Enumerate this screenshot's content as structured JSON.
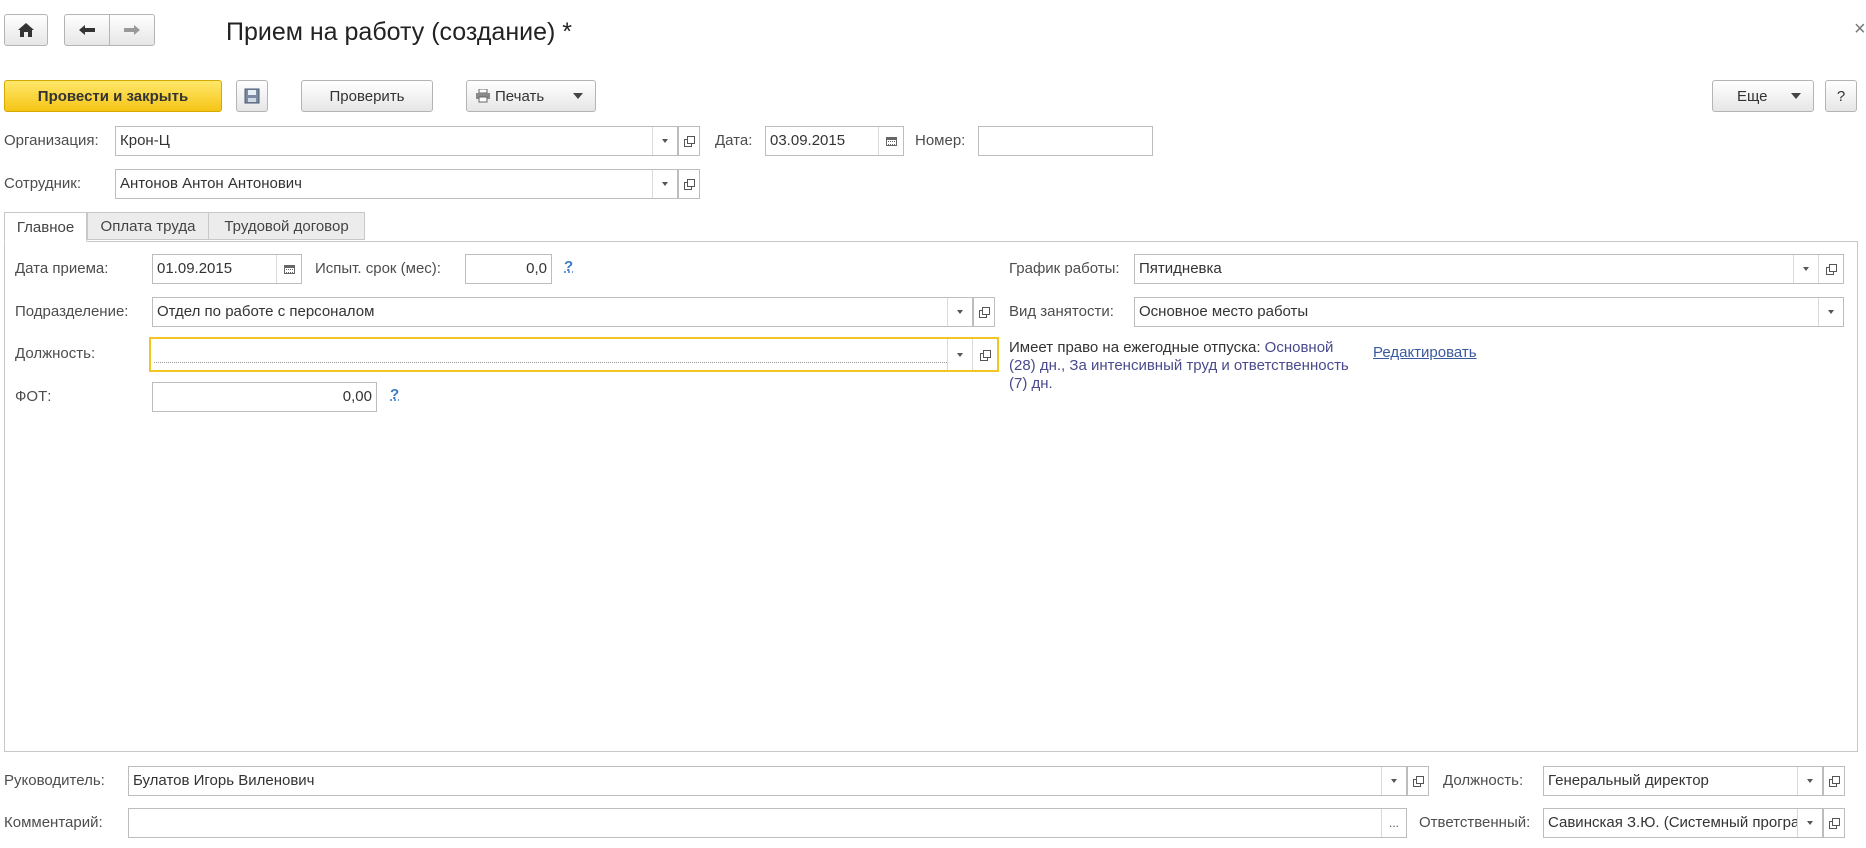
{
  "window": {
    "title": "Прием на работу (создание) *"
  },
  "nav": {
    "home_icon": "home-icon",
    "back_icon": "arrow-left-icon",
    "forward_icon": "arrow-right-icon"
  },
  "toolbar": {
    "post_close_label": "Провести и закрыть",
    "check_label": "Проверить",
    "print_label": "Печать",
    "more_label": "Еще",
    "help_label": "?"
  },
  "header": {
    "org_label": "Организация:",
    "org_value": "Крон-Ц",
    "date_label": "Дата:",
    "date_value": "03.09.2015",
    "number_label": "Номер:",
    "number_value": "",
    "employee_label": "Сотрудник:",
    "employee_value": "Антонов Антон Антонович"
  },
  "tabs": [
    {
      "label": "Главное",
      "active": true
    },
    {
      "label": "Оплата труда",
      "active": false
    },
    {
      "label": "Трудовой договор",
      "active": false
    }
  ],
  "main": {
    "hire_date_label": "Дата приема:",
    "hire_date_value": "01.09.2015",
    "probation_label": "Испыт. срок (мес):",
    "probation_value": "0,0",
    "help_mark": "?",
    "department_label": "Подразделение:",
    "department_value": "Отдел по работе с персоналом",
    "position_label": "Должность:",
    "position_value": "",
    "fot_label": "ФОТ:",
    "fot_value": "0,00",
    "schedule_label": "График работы:",
    "schedule_value": "Пятидневка",
    "employment_label": "Вид занятости:",
    "employment_value": "Основное место работы",
    "vacation_prefix": "Имеет право на ежегодные отпуска:",
    "vacation_text": "Основной (28) дн., За интенсивный труд и ответственность (7) дн.",
    "edit_link": "Редактировать"
  },
  "footer": {
    "manager_label": "Руководитель:",
    "manager_value": "Булатов Игорь Виленович",
    "manager_position_label": "Должность:",
    "manager_position_value": "Генеральный директор",
    "comment_label": "Комментарий:",
    "comment_value": "",
    "comment_button": "...",
    "responsible_label": "Ответственный:",
    "responsible_value": "Савинская З.Ю. (Системный програ"
  },
  "close_label": "×"
}
